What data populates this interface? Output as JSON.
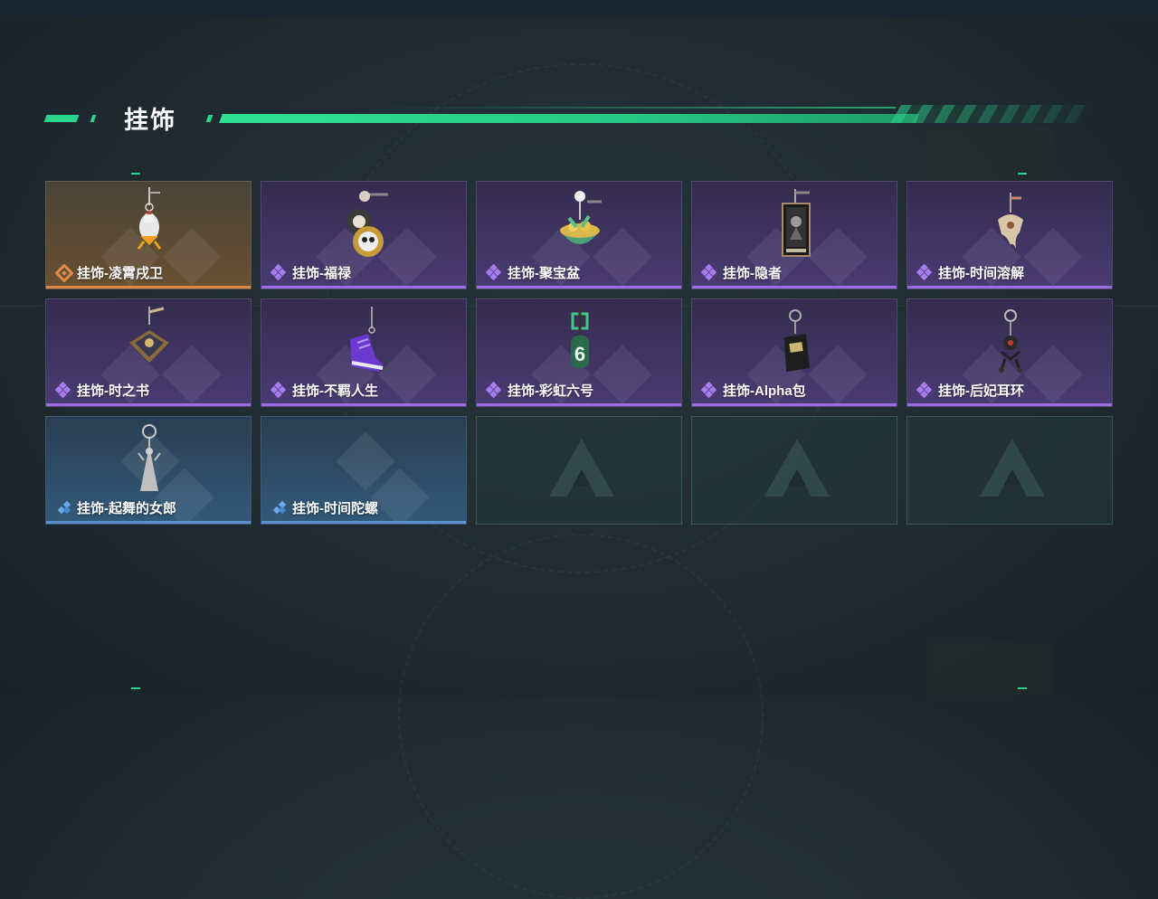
{
  "header": {
    "title": "挂饰"
  },
  "colors": {
    "accent": "#2bd38d",
    "rarity_orange": "#d98a4a",
    "rarity_purple": "#9a6ee0",
    "rarity_blue": "#5b8fd0"
  },
  "items": [
    {
      "label": "挂饰-凌霄戌卫",
      "rarity": "orange",
      "icon": "rooster-charm"
    },
    {
      "label": "挂饰-福禄",
      "rarity": "purple",
      "icon": "panda-gourd-charm"
    },
    {
      "label": "挂饰-聚宝盆",
      "rarity": "purple",
      "icon": "treasure-bowl-charm"
    },
    {
      "label": "挂饰-隐者",
      "rarity": "purple",
      "icon": "tarot-card-charm"
    },
    {
      "label": "挂饰-时间溶解",
      "rarity": "purple",
      "icon": "melting-clock-charm"
    },
    {
      "label": "挂饰-时之书",
      "rarity": "purple",
      "icon": "book-charm"
    },
    {
      "label": "挂饰-不羁人生",
      "rarity": "purple",
      "icon": "sneaker-charm"
    },
    {
      "label": "挂饰-彩虹六号",
      "rarity": "purple",
      "icon": "rainbow-six-charm"
    },
    {
      "label": "挂饰-Alpha包",
      "rarity": "purple",
      "icon": "alpha-pack-charm"
    },
    {
      "label": "挂饰-后妃耳环",
      "rarity": "purple",
      "icon": "earring-charm"
    },
    {
      "label": "挂饰-起舞的女郎",
      "rarity": "blue",
      "icon": "dancer-charm"
    },
    {
      "label": "挂饰-时间陀螺",
      "rarity": "blue",
      "icon": "spinning-top-charm"
    }
  ],
  "empty_slots": 3
}
